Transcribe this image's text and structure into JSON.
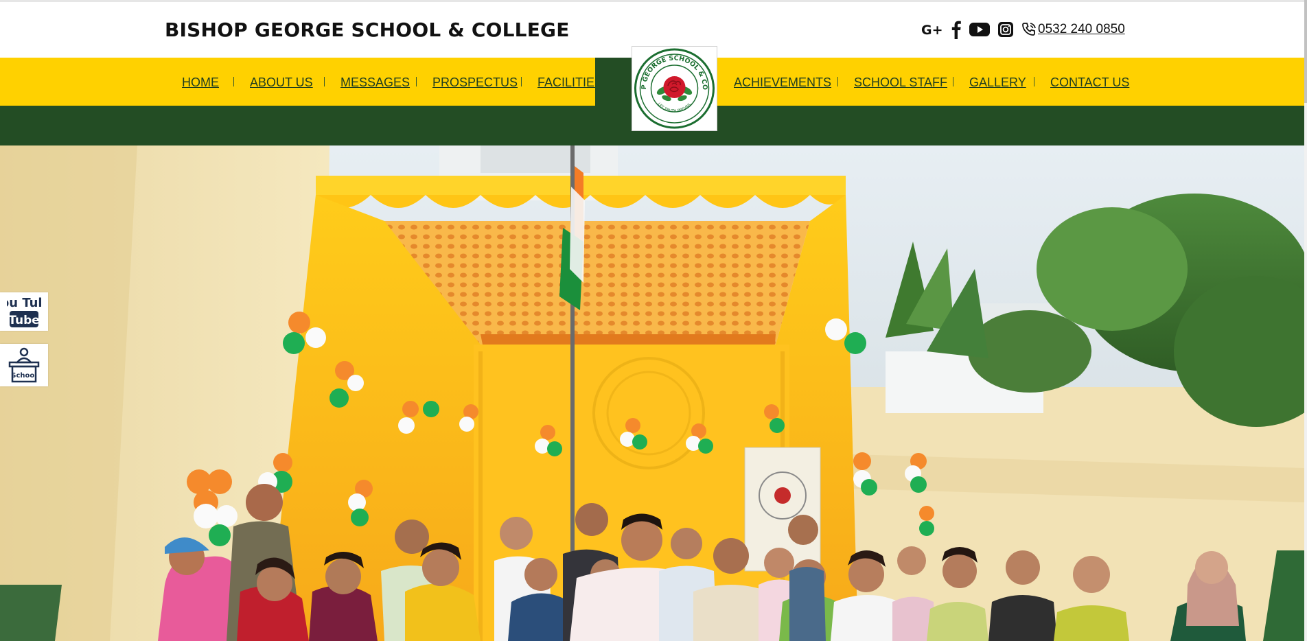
{
  "header": {
    "site_title": "BISHOP GEORGE SCHOOL & COLLEGE",
    "phone": "0532 240 0850",
    "social_icons": [
      "google-plus-icon",
      "facebook-icon",
      "youtube-icon",
      "instagram-icon",
      "phone-icon"
    ]
  },
  "nav": {
    "left": [
      "HOME",
      "ABOUT US",
      "MESSAGES",
      "PROSPECTUS",
      "FACILITIES"
    ],
    "right": [
      "ACHIEVEMENTS",
      "SCHOOL STAFF",
      "GALLERY",
      "CONTACT US"
    ]
  },
  "logo": {
    "ring_text": "BISHOP GEORGE SCHOOL & COLLEGE",
    "motto": "LET TRUTH PREVAIL"
  },
  "sidebar": {
    "youtube_label": "You Tube",
    "school_label": "School"
  },
  "colors": {
    "nav_yellow": "#ffd100",
    "dark_green": "#234d24",
    "logo_red": "#d0192b"
  }
}
